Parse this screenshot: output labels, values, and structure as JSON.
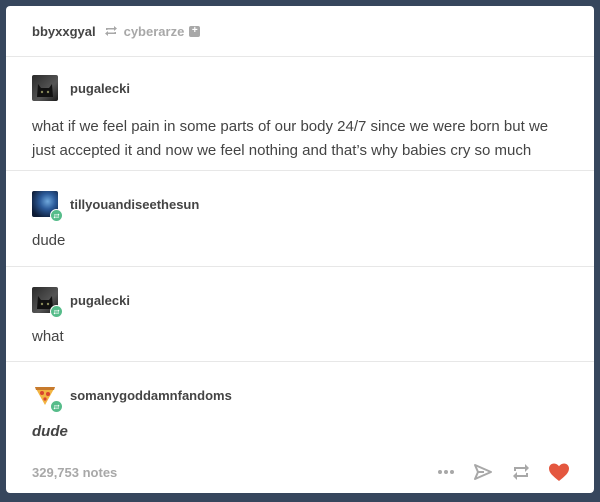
{
  "header": {
    "reblogger": "bbyxxgyal",
    "reblog_icon": "reblog-icon",
    "source_user": "cyberarze",
    "follow_icon": "plus-icon",
    "follow_symbol": "+"
  },
  "thread": [
    {
      "author": "pugalecki",
      "avatar": "black-cat-avatar",
      "has_reblog_badge": false,
      "text": "what if we feel pain in some parts of our body 24/7 since we were born but we just accepted it and now we feel nothing and that’s why babies cry so much"
    },
    {
      "author": "tillyouandiseethesun",
      "avatar": "blue-galaxy-avatar",
      "has_reblog_badge": true,
      "text": "dude"
    },
    {
      "author": "pugalecki",
      "avatar": "black-cat-avatar",
      "has_reblog_badge": true,
      "text": "what"
    },
    {
      "author": "somanygoddamnfandoms",
      "avatar": "pizza-slice-avatar",
      "has_reblog_badge": true,
      "text": "dude",
      "text_style": "bold-italic"
    }
  ],
  "footer": {
    "notes": "329,753 notes",
    "actions": [
      "more-icon",
      "share-icon",
      "reblog-icon",
      "like-icon"
    ]
  },
  "colors": {
    "background": "#36465d",
    "card": "#ffffff",
    "reblog_badge": "#56bc8a",
    "like": "#e4573f",
    "muted": "#a8a8a8"
  }
}
